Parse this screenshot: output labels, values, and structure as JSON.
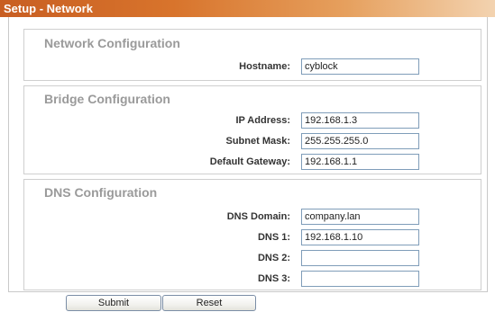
{
  "header": {
    "title": "Setup - Network"
  },
  "network": {
    "title": "Network Configuration",
    "hostname_label": "Hostname:",
    "hostname_value": "cyblock"
  },
  "bridge": {
    "title": "Bridge Configuration",
    "ip_label": "IP Address:",
    "ip_value": "192.168.1.3",
    "mask_label": "Subnet Mask:",
    "mask_value": "255.255.255.0",
    "gateway_label": "Default Gateway:",
    "gateway_value": "192.168.1.1"
  },
  "dns": {
    "title": "DNS Configuration",
    "domain_label": "DNS Domain:",
    "domain_value": "company.lan",
    "dns1_label": "DNS 1:",
    "dns1_value": "192.168.1.10",
    "dns2_label": "DNS 2:",
    "dns2_value": "",
    "dns3_label": "DNS 3:",
    "dns3_value": ""
  },
  "actions": {
    "submit_label": "Submit",
    "reset_label": "Reset"
  },
  "colors": {
    "title_bar": "#c85e22",
    "section_title": "#9a9a9a",
    "input_border": "#7f9db9"
  }
}
